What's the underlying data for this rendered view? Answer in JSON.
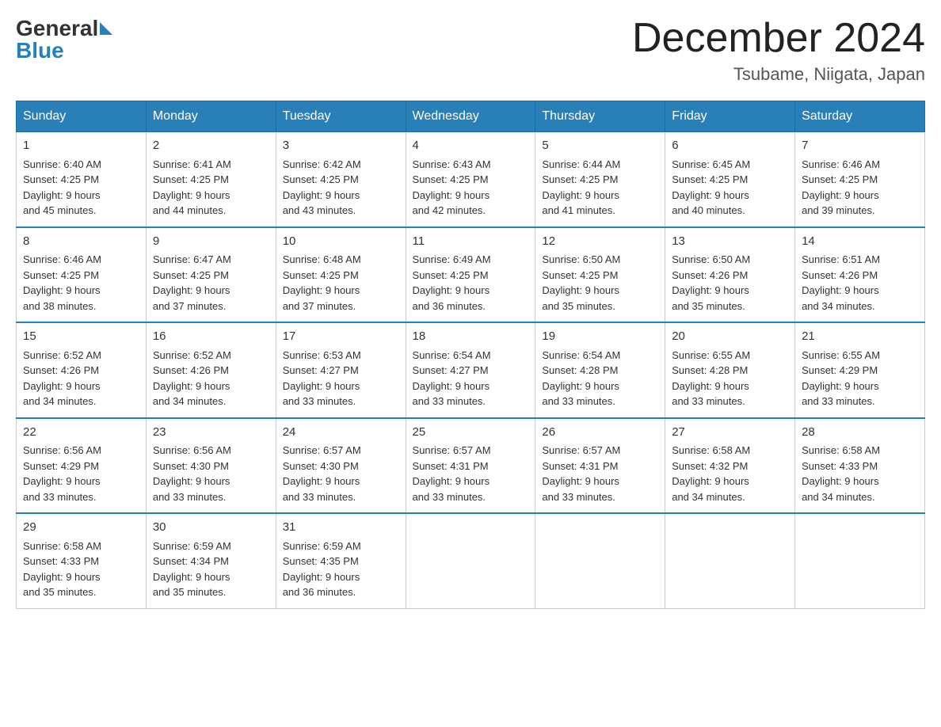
{
  "header": {
    "title": "December 2024",
    "subtitle": "Tsubame, Niigata, Japan",
    "logo_line1": "General",
    "logo_line2": "Blue"
  },
  "weekdays": [
    "Sunday",
    "Monday",
    "Tuesday",
    "Wednesday",
    "Thursday",
    "Friday",
    "Saturday"
  ],
  "weeks": [
    [
      {
        "day": "1",
        "sunrise": "6:40 AM",
        "sunset": "4:25 PM",
        "daylight": "9 hours and 45 minutes."
      },
      {
        "day": "2",
        "sunrise": "6:41 AM",
        "sunset": "4:25 PM",
        "daylight": "9 hours and 44 minutes."
      },
      {
        "day": "3",
        "sunrise": "6:42 AM",
        "sunset": "4:25 PM",
        "daylight": "9 hours and 43 minutes."
      },
      {
        "day": "4",
        "sunrise": "6:43 AM",
        "sunset": "4:25 PM",
        "daylight": "9 hours and 42 minutes."
      },
      {
        "day": "5",
        "sunrise": "6:44 AM",
        "sunset": "4:25 PM",
        "daylight": "9 hours and 41 minutes."
      },
      {
        "day": "6",
        "sunrise": "6:45 AM",
        "sunset": "4:25 PM",
        "daylight": "9 hours and 40 minutes."
      },
      {
        "day": "7",
        "sunrise": "6:46 AM",
        "sunset": "4:25 PM",
        "daylight": "9 hours and 39 minutes."
      }
    ],
    [
      {
        "day": "8",
        "sunrise": "6:46 AM",
        "sunset": "4:25 PM",
        "daylight": "9 hours and 38 minutes."
      },
      {
        "day": "9",
        "sunrise": "6:47 AM",
        "sunset": "4:25 PM",
        "daylight": "9 hours and 37 minutes."
      },
      {
        "day": "10",
        "sunrise": "6:48 AM",
        "sunset": "4:25 PM",
        "daylight": "9 hours and 37 minutes."
      },
      {
        "day": "11",
        "sunrise": "6:49 AM",
        "sunset": "4:25 PM",
        "daylight": "9 hours and 36 minutes."
      },
      {
        "day": "12",
        "sunrise": "6:50 AM",
        "sunset": "4:25 PM",
        "daylight": "9 hours and 35 minutes."
      },
      {
        "day": "13",
        "sunrise": "6:50 AM",
        "sunset": "4:26 PM",
        "daylight": "9 hours and 35 minutes."
      },
      {
        "day": "14",
        "sunrise": "6:51 AM",
        "sunset": "4:26 PM",
        "daylight": "9 hours and 34 minutes."
      }
    ],
    [
      {
        "day": "15",
        "sunrise": "6:52 AM",
        "sunset": "4:26 PM",
        "daylight": "9 hours and 34 minutes."
      },
      {
        "day": "16",
        "sunrise": "6:52 AM",
        "sunset": "4:26 PM",
        "daylight": "9 hours and 34 minutes."
      },
      {
        "day": "17",
        "sunrise": "6:53 AM",
        "sunset": "4:27 PM",
        "daylight": "9 hours and 33 minutes."
      },
      {
        "day": "18",
        "sunrise": "6:54 AM",
        "sunset": "4:27 PM",
        "daylight": "9 hours and 33 minutes."
      },
      {
        "day": "19",
        "sunrise": "6:54 AM",
        "sunset": "4:28 PM",
        "daylight": "9 hours and 33 minutes."
      },
      {
        "day": "20",
        "sunrise": "6:55 AM",
        "sunset": "4:28 PM",
        "daylight": "9 hours and 33 minutes."
      },
      {
        "day": "21",
        "sunrise": "6:55 AM",
        "sunset": "4:29 PM",
        "daylight": "9 hours and 33 minutes."
      }
    ],
    [
      {
        "day": "22",
        "sunrise": "6:56 AM",
        "sunset": "4:29 PM",
        "daylight": "9 hours and 33 minutes."
      },
      {
        "day": "23",
        "sunrise": "6:56 AM",
        "sunset": "4:30 PM",
        "daylight": "9 hours and 33 minutes."
      },
      {
        "day": "24",
        "sunrise": "6:57 AM",
        "sunset": "4:30 PM",
        "daylight": "9 hours and 33 minutes."
      },
      {
        "day": "25",
        "sunrise": "6:57 AM",
        "sunset": "4:31 PM",
        "daylight": "9 hours and 33 minutes."
      },
      {
        "day": "26",
        "sunrise": "6:57 AM",
        "sunset": "4:31 PM",
        "daylight": "9 hours and 33 minutes."
      },
      {
        "day": "27",
        "sunrise": "6:58 AM",
        "sunset": "4:32 PM",
        "daylight": "9 hours and 34 minutes."
      },
      {
        "day": "28",
        "sunrise": "6:58 AM",
        "sunset": "4:33 PM",
        "daylight": "9 hours and 34 minutes."
      }
    ],
    [
      {
        "day": "29",
        "sunrise": "6:58 AM",
        "sunset": "4:33 PM",
        "daylight": "9 hours and 35 minutes."
      },
      {
        "day": "30",
        "sunrise": "6:59 AM",
        "sunset": "4:34 PM",
        "daylight": "9 hours and 35 minutes."
      },
      {
        "day": "31",
        "sunrise": "6:59 AM",
        "sunset": "4:35 PM",
        "daylight": "9 hours and 36 minutes."
      },
      null,
      null,
      null,
      null
    ]
  ],
  "labels": {
    "sunrise": "Sunrise:",
    "sunset": "Sunset:",
    "daylight": "Daylight:"
  }
}
